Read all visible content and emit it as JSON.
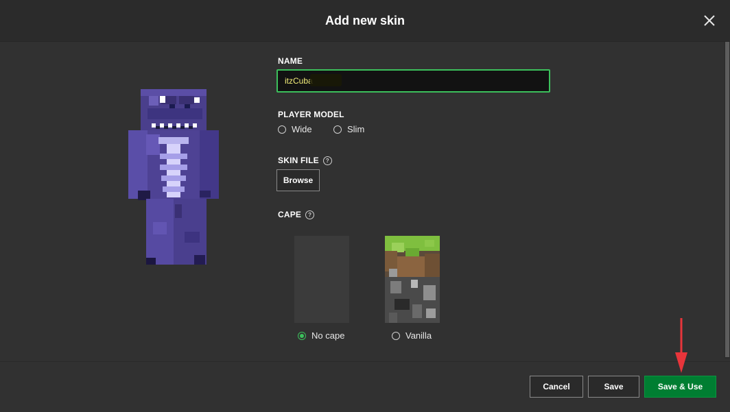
{
  "dialog": {
    "title": "Add new skin"
  },
  "name_section": {
    "label": "NAME",
    "value": "itzCuba"
  },
  "player_model": {
    "label": "PLAYER MODEL",
    "options": [
      "Wide",
      "Slim"
    ]
  },
  "skin_file": {
    "label": "SKIN FILE",
    "help": "?",
    "browse_label": "Browse"
  },
  "cape": {
    "label": "CAPE",
    "help": "?",
    "options": [
      {
        "label": "No cape",
        "selected": true
      },
      {
        "label": "Vanilla",
        "selected": false
      }
    ]
  },
  "footer": {
    "cancel_label": "Cancel",
    "save_label": "Save",
    "save_use_label": "Save & Use"
  },
  "icons": [
    "close-icon",
    "help-icon",
    "red-arrow-annotation"
  ],
  "colors": {
    "accent": "#3cc15c",
    "primary_button": "#007e32",
    "background": "#313131",
    "annotation": "#e8353b"
  }
}
